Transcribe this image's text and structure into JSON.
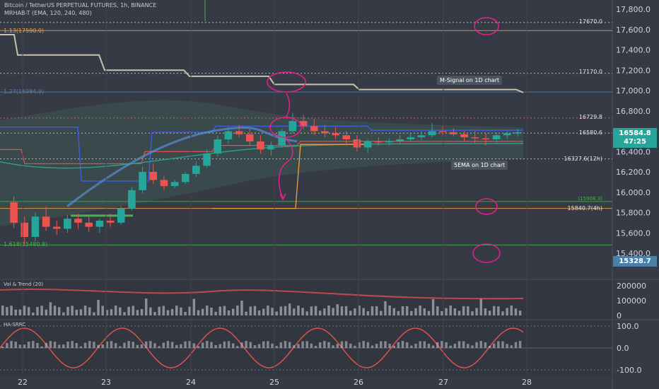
{
  "header": {
    "symbol_line": "Bitcoin / TetherUS PERPETUAL FUTURES, 1h, BINANCE",
    "indicator_line": "MRHAB-T (EMA, 120, 240, 480)"
  },
  "fib_labels": {
    "f113": "1.13(17590.0)",
    "f127": "1.27(16984.9)",
    "f1618": "1.618(15480.8)"
  },
  "price_labels": {
    "p17670": "17670.0",
    "p17170": "17170.0",
    "p16729": "16729.8",
    "p16580": "16580.6",
    "p16327": "16327.6(12h)",
    "p15908": "(15908.3)",
    "p15840": "15840.7(4h)"
  },
  "annotations": {
    "msignal": "M-Signal on 1D chart",
    "ema5": "5EMA on 1D chart"
  },
  "badges": {
    "current_price": "16584.8",
    "countdown": "47:25",
    "low_price": "15328.7"
  },
  "panes": {
    "volume_title": "Vol & Trend (20)",
    "osc_title": "HA-SRRC"
  },
  "colors": {
    "background": "#363a45",
    "bull": "#26a69a",
    "bear": "#ef5350",
    "orange": "#f0a04b",
    "green_line": "#4caf50",
    "magenta": "#e91e8c"
  },
  "chart_data": {
    "type": "candlestick",
    "price_axis": {
      "ticks": [
        15400,
        15600,
        15800,
        16000,
        16200,
        16400,
        16600,
        16800,
        17000,
        17200,
        17400,
        17600,
        17800
      ],
      "range": [
        15250,
        17880
      ]
    },
    "volume_axis": {
      "ticks": [
        "0",
        "100000",
        "200000"
      ]
    },
    "oscillator_axis": {
      "ticks": [
        "-100.0",
        "0.0",
        "100.0"
      ]
    },
    "x_ticks": [
      "22",
      "23",
      "24",
      "25",
      "26",
      "27",
      "28"
    ],
    "horizontal_levels": [
      {
        "name": "1.13",
        "value": 17590.0
      },
      {
        "name": "1.27",
        "value": 16984.9
      },
      {
        "name": "1.618",
        "value": 15480.8
      },
      {
        "value": 17670.0
      },
      {
        "value": 17170.0
      },
      {
        "value": 16729.8
      },
      {
        "value": 16580.6
      },
      {
        "value": 16327.6
      },
      {
        "value": 15908.3
      },
      {
        "value": 15840.7
      }
    ],
    "candles": [
      [
        15900,
        15960,
        15650,
        15700
      ],
      [
        15700,
        15760,
        15480,
        15560
      ],
      [
        15560,
        15800,
        15520,
        15760
      ],
      [
        15760,
        15860,
        15620,
        15660
      ],
      [
        15660,
        15720,
        15580,
        15640
      ],
      [
        15640,
        15780,
        15600,
        15740
      ],
      [
        15740,
        15790,
        15640,
        15700
      ],
      [
        15700,
        15760,
        15610,
        15660
      ],
      [
        15660,
        15740,
        15600,
        15720
      ],
      [
        15720,
        15790,
        15660,
        15700
      ],
      [
        15700,
        15860,
        15680,
        15840
      ],
      [
        15840,
        16050,
        15820,
        16020
      ],
      [
        16020,
        16250,
        15990,
        16200
      ],
      [
        16200,
        16280,
        16080,
        16120
      ],
      [
        16120,
        16160,
        16020,
        16060
      ],
      [
        16060,
        16120,
        16040,
        16100
      ],
      [
        16100,
        16200,
        16080,
        16180
      ],
      [
        16180,
        16300,
        16150,
        16260
      ],
      [
        16260,
        16420,
        16240,
        16380
      ],
      [
        16380,
        16560,
        16350,
        16520
      ],
      [
        16520,
        16640,
        16480,
        16600
      ],
      [
        16600,
        16660,
        16540,
        16570
      ],
      [
        16570,
        16620,
        16460,
        16500
      ],
      [
        16500,
        16560,
        16380,
        16420
      ],
      [
        16420,
        16500,
        16360,
        16460
      ],
      [
        16460,
        16620,
        16440,
        16600
      ],
      [
        16600,
        16780,
        16580,
        16700
      ],
      [
        16700,
        16760,
        16620,
        16650
      ],
      [
        16650,
        16720,
        16560,
        16600
      ],
      [
        16600,
        16660,
        16540,
        16580
      ],
      [
        16580,
        16640,
        16520,
        16560
      ],
      [
        16560,
        16600,
        16460,
        16520
      ],
      [
        16520,
        16560,
        16400,
        16440
      ],
      [
        16440,
        16520,
        16380,
        16500
      ],
      [
        16500,
        16540,
        16460,
        16490
      ],
      [
        16490,
        16530,
        16460,
        16500
      ],
      [
        16500,
        16560,
        16480,
        16520
      ],
      [
        16520,
        16580,
        16500,
        16540
      ],
      [
        16540,
        16600,
        16510,
        16560
      ],
      [
        16560,
        16680,
        16540,
        16600
      ],
      [
        16600,
        16650,
        16560,
        16590
      ],
      [
        16590,
        16630,
        16550,
        16570
      ],
      [
        16570,
        16600,
        16500,
        16540
      ],
      [
        16540,
        16600,
        16480,
        16530
      ],
      [
        16530,
        16580,
        16460,
        16520
      ],
      [
        16520,
        16590,
        16490,
        16560
      ],
      [
        16560,
        16600,
        16520,
        16580
      ],
      [
        16580,
        16620,
        16550,
        16590
      ]
    ]
  }
}
